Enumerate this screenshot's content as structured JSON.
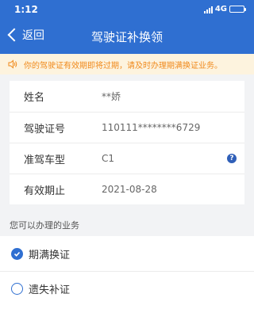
{
  "status_bar": {
    "time": "1:12",
    "network": "4G",
    "battery_level": 0.45
  },
  "nav": {
    "back_label": "返回",
    "title": "驾驶证补换领"
  },
  "notice": {
    "text": "你的驾驶证有效期即将过期，请及时办理期满换证业务。",
    "color": "#f08a1c"
  },
  "license_info": [
    {
      "label": "姓名",
      "value": "**娇"
    },
    {
      "label": "驾驶证号",
      "value": "110111********6729"
    },
    {
      "label": "准驾车型",
      "value": "C1",
      "help_icon": "?"
    },
    {
      "label": "有效期止",
      "value": "2021-08-28"
    }
  ],
  "services": {
    "title": "您可以办理的业务",
    "options": [
      {
        "label": "期满换证",
        "checked": true
      },
      {
        "label": "遗失补证",
        "checked": false
      }
    ]
  },
  "colors": {
    "brand": "#2f6fd1",
    "notice_bg": "#fdf3de"
  }
}
